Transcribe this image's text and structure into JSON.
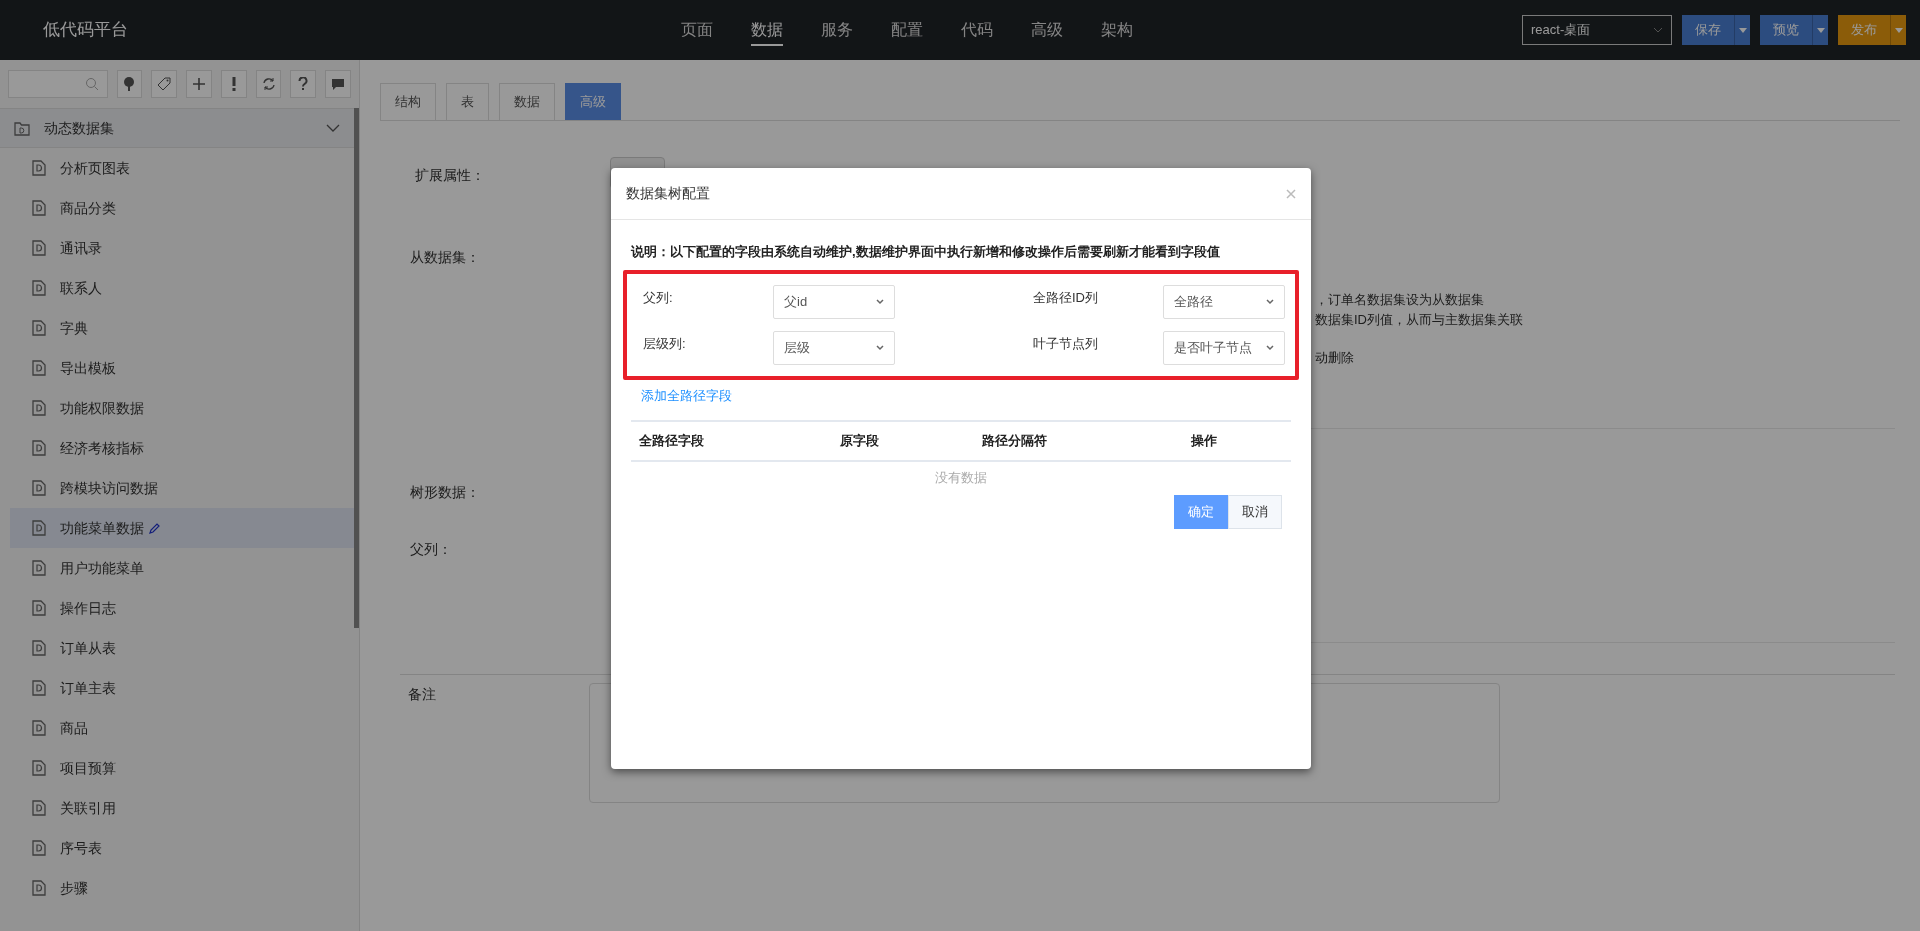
{
  "app": {
    "title": "低代码平台"
  },
  "nav": [
    {
      "label": "页面",
      "selected": false
    },
    {
      "label": "数据",
      "selected": true
    },
    {
      "label": "服务",
      "selected": false
    },
    {
      "label": "配置",
      "selected": false
    },
    {
      "label": "代码",
      "selected": false
    },
    {
      "label": "高级",
      "selected": false
    },
    {
      "label": "架构",
      "selected": false
    }
  ],
  "header_controls": {
    "app_select": "react-桌面",
    "buttons": [
      {
        "label": "保存",
        "kind": "primary"
      },
      {
        "label": "预览",
        "kind": "primary"
      },
      {
        "label": "发布",
        "kind": "warning"
      }
    ]
  },
  "sidebar": {
    "tree": [
      {
        "label": "动态数据集",
        "expanded": true,
        "children": [
          {
            "label": "分析页图表",
            "selected": false
          },
          {
            "label": "商品分类",
            "selected": false
          },
          {
            "label": "通讯录",
            "selected": false
          },
          {
            "label": "联系人",
            "selected": false
          },
          {
            "label": "字典",
            "selected": false
          },
          {
            "label": "导出模板",
            "selected": false
          },
          {
            "label": "功能权限数据",
            "selected": false
          },
          {
            "label": "经济考核指标",
            "selected": false
          },
          {
            "label": "跨模块访问数据",
            "selected": false
          },
          {
            "label": "功能菜单数据",
            "selected": true
          },
          {
            "label": "用户功能菜单",
            "selected": false
          },
          {
            "label": "操作日志",
            "selected": false
          },
          {
            "label": "订单从表",
            "selected": false
          },
          {
            "label": "订单主表",
            "selected": false
          },
          {
            "label": "商品",
            "selected": false
          },
          {
            "label": "项目预算",
            "selected": false
          },
          {
            "label": "关联引用",
            "selected": false
          },
          {
            "label": "序号表",
            "selected": false
          },
          {
            "label": "步骤",
            "selected": false
          }
        ]
      }
    ]
  },
  "main": {
    "tabs": [
      {
        "label": "结构",
        "selected": false
      },
      {
        "label": "表",
        "selected": false
      },
      {
        "label": "数据",
        "selected": false
      },
      {
        "label": "高级",
        "selected": true
      }
    ],
    "labels": [
      "扩展属性：",
      "从数据集：",
      "树形数据：",
      "父列："
    ],
    "side_notes": [
      "，订单名数据集设为从数据集",
      "数据集ID列值，从而与主数据集关联",
      "动删除"
    ],
    "remark_label": "备注"
  },
  "modal": {
    "title": "数据集树配置",
    "note": "说明：以下配置的字段由系统自动维护,数据维护界面中执行新增和修改操作后需要刷新才能看到字段值",
    "fields": [
      {
        "label": "父列:",
        "value": "父id"
      },
      {
        "label": "全路径ID列",
        "value": "全路径"
      },
      {
        "label": "层级列:",
        "value": "层级"
      },
      {
        "label": "叶子节点列",
        "value": "是否叶子节点"
      }
    ],
    "add_link": "添加全路径字段",
    "table": {
      "columns": [
        "全路径字段",
        "原字段",
        "路径分隔符",
        "操作"
      ],
      "empty_text": "没有数据"
    },
    "buttons": [
      {
        "label": "确定",
        "kind": "primary"
      },
      {
        "label": "取消",
        "kind": "default"
      }
    ]
  }
}
